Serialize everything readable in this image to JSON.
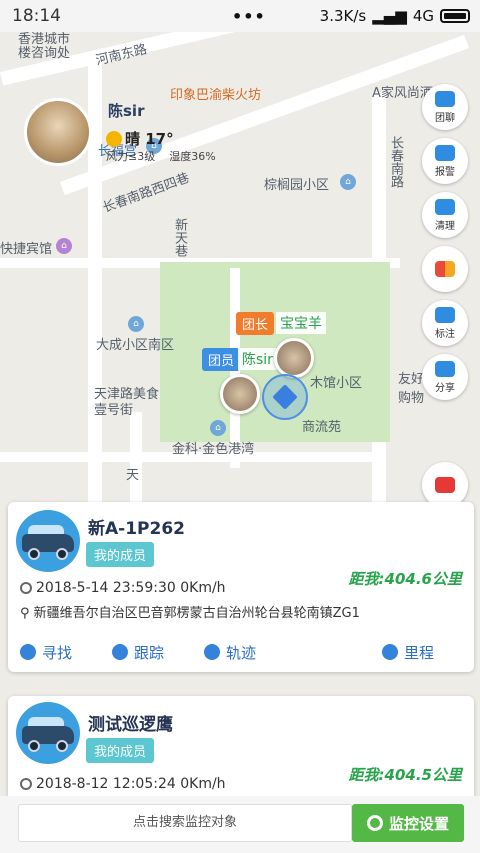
{
  "status": {
    "time": "18:14",
    "dots": "•••",
    "net": "3.3K/s",
    "signal": "4G"
  },
  "map": {
    "labels": [
      "香港城市",
      "楼咨询处",
      "河南东路",
      "印象巴渝柴火坊",
      "A家风尚酒店",
      "长福宫",
      "长春南路西四巷",
      "棕榈园小区",
      "长春南路",
      "新天巷",
      "快捷宾馆",
      "大成小区南区",
      "天津路美食壹号街",
      "商流苑",
      "金科·金色港湾",
      "木馆小区",
      "友好购物",
      "天"
    ],
    "weather": {
      "name": "陈sir",
      "temp": "晴 17°",
      "wind": "风力≤3级",
      "humidity": "湿度36%"
    },
    "markers": [
      {
        "role": "团长",
        "name": "宝宝羊"
      },
      {
        "role": "团员",
        "name": "陈sir"
      }
    ]
  },
  "tools": [
    {
      "icon": "chat-icon",
      "label": "团聊"
    },
    {
      "icon": "alarm-icon",
      "label": "报警"
    },
    {
      "icon": "broom-icon",
      "label": "清理"
    },
    {
      "icon": "grid-icon",
      "label": ""
    },
    {
      "icon": "flag-icon",
      "label": "标注"
    },
    {
      "icon": "share-icon",
      "label": "分享"
    }
  ],
  "cards": [
    {
      "plate": "新A-1P262",
      "badge": "我的成员",
      "time": "2018-5-14 23:59:30    0Km/h",
      "distance": "距我:404.6公里",
      "address": "新疆维吾尔自治区巴音郭楞蒙古自治州轮台县轮南镇ZG1"
    },
    {
      "plate": "测试巡逻鹰",
      "badge": "我的成员",
      "time": "2018-8-12 12:05:24    0Km/h",
      "distance": "距我:404.5公里"
    }
  ],
  "actions": [
    "寻找",
    "跟踪",
    "轨迹",
    "里程"
  ],
  "bottom": {
    "search_placeholder": "点击搜索监控对象",
    "monitor_label": "监控设置"
  }
}
